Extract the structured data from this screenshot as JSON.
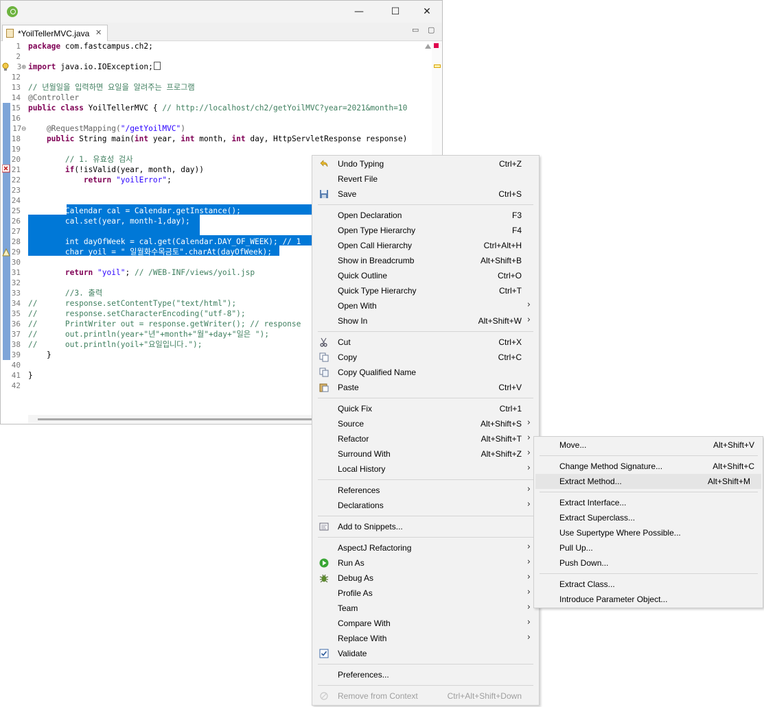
{
  "window": {
    "minimize_glyph": "—",
    "maximize_glyph": "☐",
    "close_glyph": "✕"
  },
  "editor_tab": {
    "title": "*YoilTellerMVC.java",
    "close_glyph": "✕",
    "minimize_glyph": "▭",
    "maximize_glyph": "▢"
  },
  "line_numbers": [
    "1",
    "2",
    "3⊕",
    "12",
    "13",
    "14",
    "15",
    "16",
    "17⊖",
    "18",
    "19",
    "20",
    "21",
    "22",
    "23",
    "24",
    "25",
    "26",
    "27",
    "28",
    "29",
    "30",
    "31",
    "32",
    "33",
    "34",
    "35",
    "36",
    "37",
    "38",
    "39",
    "40",
    "41",
    "42"
  ],
  "code": {
    "l1a": "package",
    "l1b": " com.fastcampus.ch2;",
    "l3a": "import",
    "l3b": " java.io.IOException;",
    "l13": "// 년월일을 입력하면 요일을 알려주는 프로그램",
    "l14": "@Controller",
    "l15a": "public class",
    "l15b": " YoilTellerMVC { ",
    "l15c": "// http://localhost/ch2/getYoilMVC?year=2021&month=10",
    "l17a": "    @RequestMapping(",
    "l17b": "\"/getYoilMVC\"",
    "l17c": ")",
    "l18a": "    public",
    "l18b": " String main(",
    "l18c": "int",
    "l18d": " year, ",
    "l18e": "int",
    "l18f": " month, ",
    "l18g": "int",
    "l18h": " day, HttpServletResponse response)",
    "l20": "        // 1. 유효성 검사",
    "l21a": "        if",
    "l21b": "(!isValid(year, month, day))",
    "l22a": "            return",
    "l22b": " ",
    "l22c": "\"yoilError\"",
    "l22d": ";",
    "l25": "        Calendar cal = Calendar.getInstance();",
    "l26": "        cal.set(year, month-1,day);",
    "l28": "        int dayOfWeek = cal.get(Calendar.DAY_OF_WEEK); // 1",
    "l29": "        char yoil = \" 일월화수목금토\".charAt(dayOfWeek);",
    "l31a": "        return",
    "l31b": " ",
    "l31c": "\"yoil\"",
    "l31d": "; ",
    "l31e": "// /WEB-INF/views/yoil.jsp",
    "l33": "        //3. 출력",
    "l34": "//      response.setContentType(\"text/html\");",
    "l35": "//      response.setCharacterEncoding(\"utf-8\");",
    "l36": "//      PrintWriter out = response.getWriter(); // response",
    "l37": "//      out.println(year+\"년\"+month+\"월\"+day+\"일은 \");",
    "l38": "//      out.println(yoil+\"요일입니다.\");",
    "l39": "    }",
    "l41": "}"
  },
  "context_menu": {
    "items": [
      {
        "label": "Undo Typing",
        "accel": "Ctrl+Z",
        "icon": "undo-icon"
      },
      {
        "label": "Revert File",
        "accel": ""
      },
      {
        "label": "Save",
        "accel": "Ctrl+S",
        "icon": "save-icon"
      },
      {
        "label": "Open Declaration",
        "accel": "F3"
      },
      {
        "label": "Open Type Hierarchy",
        "accel": "F4"
      },
      {
        "label": "Open Call Hierarchy",
        "accel": "Ctrl+Alt+H"
      },
      {
        "label": "Show in Breadcrumb",
        "accel": "Alt+Shift+B"
      },
      {
        "label": "Quick Outline",
        "accel": "Ctrl+O"
      },
      {
        "label": "Quick Type Hierarchy",
        "accel": "Ctrl+T"
      },
      {
        "label": "Open With",
        "accel": ""
      },
      {
        "label": "Show In",
        "accel": "Alt+Shift+W"
      },
      {
        "label": "Cut",
        "accel": "Ctrl+X",
        "icon": "cut-icon"
      },
      {
        "label": "Copy",
        "accel": "Ctrl+C",
        "icon": "copy-icon"
      },
      {
        "label": "Copy Qualified Name",
        "accel": "",
        "icon": "copy-qualified-icon"
      },
      {
        "label": "Paste",
        "accel": "Ctrl+V",
        "icon": "paste-icon"
      },
      {
        "label": "Quick Fix",
        "accel": "Ctrl+1"
      },
      {
        "label": "Source",
        "accel": "Alt+Shift+S"
      },
      {
        "label": "Refactor",
        "accel": "Alt+Shift+T"
      },
      {
        "label": "Surround With",
        "accel": "Alt+Shift+Z"
      },
      {
        "label": "Local History",
        "accel": ""
      },
      {
        "label": "References",
        "accel": ""
      },
      {
        "label": "Declarations",
        "accel": ""
      },
      {
        "label": "Add to Snippets...",
        "accel": "",
        "icon": "snippet-icon"
      },
      {
        "label": "AspectJ Refactoring",
        "accel": ""
      },
      {
        "label": "Run As",
        "accel": "",
        "icon": "run-icon"
      },
      {
        "label": "Debug As",
        "accel": "",
        "icon": "debug-icon"
      },
      {
        "label": "Profile As",
        "accel": ""
      },
      {
        "label": "Team",
        "accel": ""
      },
      {
        "label": "Compare With",
        "accel": ""
      },
      {
        "label": "Replace With",
        "accel": ""
      },
      {
        "label": "Validate",
        "accel": "",
        "icon": "checkbox-icon"
      },
      {
        "label": "Preferences...",
        "accel": ""
      },
      {
        "label": "Remove from Context",
        "accel": "Ctrl+Alt+Shift+Down",
        "icon": "remove-context-icon"
      }
    ],
    "arrow_glyph": "›"
  },
  "refactor_submenu": {
    "items": [
      {
        "label": "Move...",
        "accel": "Alt+Shift+V"
      },
      {
        "label": "Change Method Signature...",
        "accel": "Alt+Shift+C"
      },
      {
        "label": "Extract Method...",
        "accel": "Alt+Shift+M"
      },
      {
        "label": "Extract Interface...",
        "accel": ""
      },
      {
        "label": "Extract Superclass...",
        "accel": ""
      },
      {
        "label": "Use Supertype Where Possible...",
        "accel": ""
      },
      {
        "label": "Pull Up...",
        "accel": ""
      },
      {
        "label": "Push Down...",
        "accel": ""
      },
      {
        "label": "Extract Class...",
        "accel": ""
      },
      {
        "label": "Introduce Parameter Object...",
        "accel": ""
      }
    ]
  },
  "colors": {
    "selection": "#0078d7",
    "keyword": "#7f0055",
    "comment": "#3f7f5f",
    "string": "#2a00ff",
    "change_bar": "#7ea5d8"
  }
}
